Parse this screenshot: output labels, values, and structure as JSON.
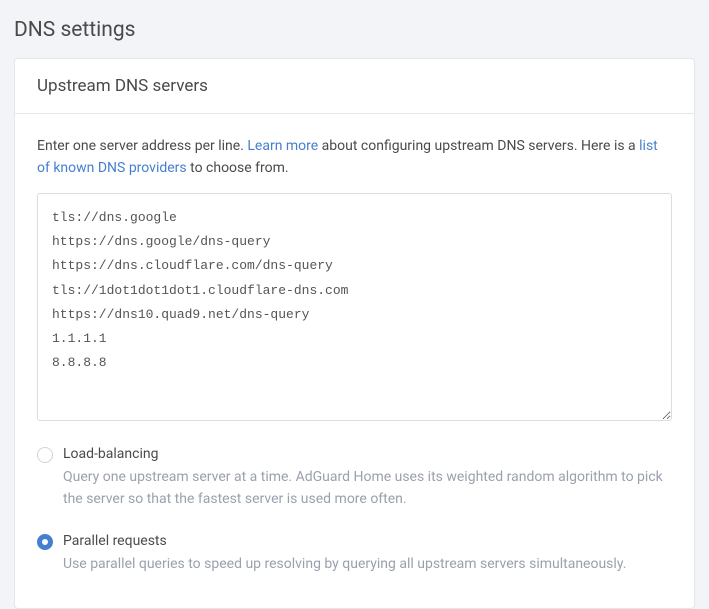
{
  "page": {
    "title": "DNS settings"
  },
  "card": {
    "title": "Upstream DNS servers"
  },
  "help": {
    "pre": "Enter one server address per line. ",
    "link1": "Learn more",
    "mid": " about configuring upstream DNS servers. Here is a ",
    "link2": "list of known DNS providers",
    "post": " to choose from."
  },
  "upstream": {
    "value": "tls://dns.google\nhttps://dns.google/dns-query\nhttps://dns.cloudflare.com/dns-query\ntls://1dot1dot1dot1.cloudflare-dns.com\nhttps://dns10.quad9.net/dns-query\n1.1.1.1\n8.8.8.8"
  },
  "mode": {
    "loadBalancing": {
      "label": "Load-balancing",
      "desc": "Query one upstream server at a time. AdGuard Home uses its weighted random algorithm to pick the server so that the fastest server is used more often."
    },
    "parallel": {
      "label": "Parallel requests",
      "desc": "Use parallel queries to speed up resolving by querying all upstream servers simultaneously."
    },
    "selected": "parallel"
  }
}
